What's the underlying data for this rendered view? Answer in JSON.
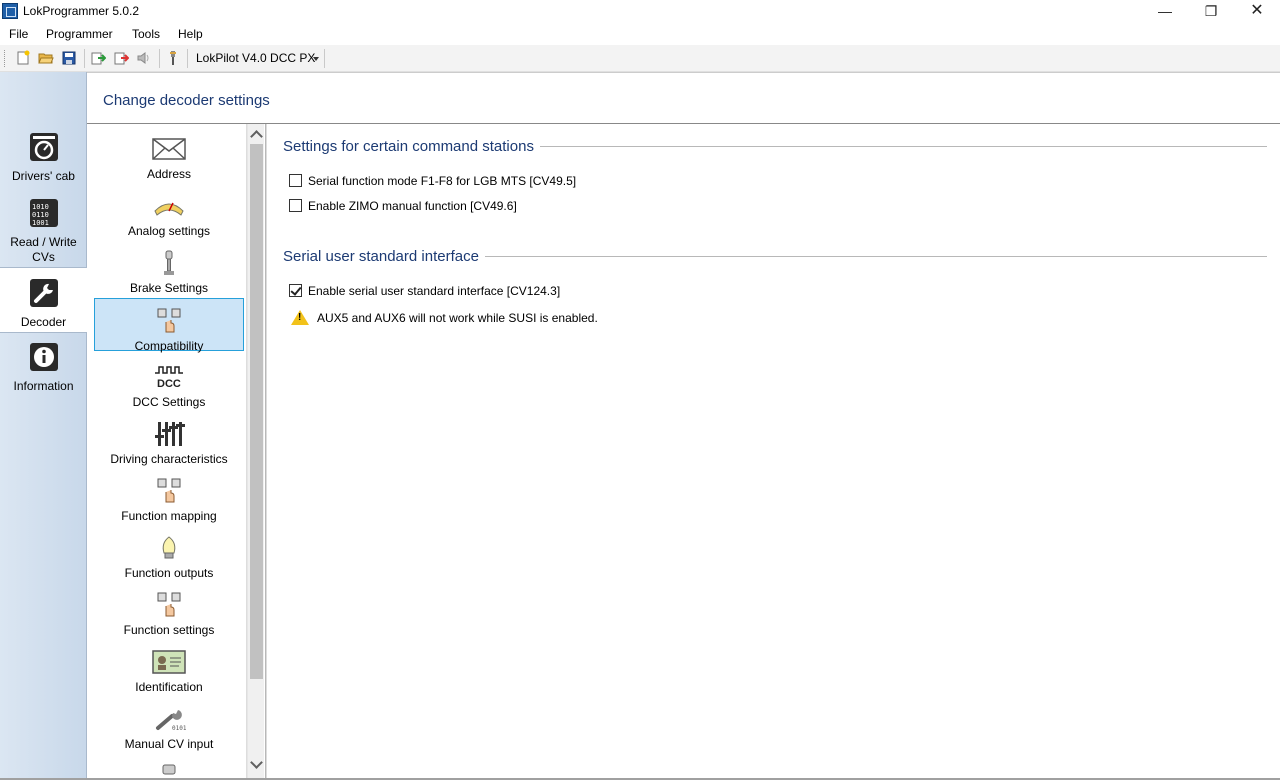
{
  "window": {
    "title": "LokProgrammer 5.0.2",
    "minimize_glyph": "—",
    "maximize_glyph": "❐",
    "close_glyph": "✕"
  },
  "menu": [
    "File",
    "Programmer",
    "Tools",
    "Help"
  ],
  "toolbar": {
    "decoder_select": "LokPilot V4.0 DCC PX",
    "icons": [
      "new-file-icon",
      "open-folder-icon",
      "save-icon",
      "import-icon",
      "export-icon",
      "speaker-icon",
      "programmer-key-icon"
    ]
  },
  "leftnav": [
    {
      "label": "Drivers' cab",
      "icon": "drivers-cab-icon"
    },
    {
      "label": "Read / Write CVs",
      "icon": "read-write-cvs-icon"
    },
    {
      "label": "Decoder",
      "icon": "wrench-icon",
      "active": true
    },
    {
      "label": "Information",
      "icon": "info-icon"
    }
  ],
  "page_title": "Change decoder settings",
  "categories": [
    {
      "label": "Address",
      "icon": "envelope-icon"
    },
    {
      "label": "Analog settings",
      "icon": "analog-gauge-icon"
    },
    {
      "label": "Brake Settings",
      "icon": "brake-icon"
    },
    {
      "label": "Compatibility",
      "icon": "hand-buttons-icon",
      "active": true
    },
    {
      "label": "DCC Settings",
      "icon": "dcc-icon",
      "icon_text": "DCC"
    },
    {
      "label": "Driving characteristics",
      "icon": "sliders-icon"
    },
    {
      "label": "Function mapping",
      "icon": "hand-buttons-icon"
    },
    {
      "label": "Function outputs",
      "icon": "light-bulb-icon"
    },
    {
      "label": "Function settings",
      "icon": "hand-buttons-icon"
    },
    {
      "label": "Identification",
      "icon": "id-card-icon"
    },
    {
      "label": "Manual CV input",
      "icon": "wrench-icon"
    }
  ],
  "sections": {
    "command_stations": {
      "title": "Settings for certain command stations",
      "options": [
        {
          "label": "Serial function mode F1-F8 for LGB MTS [CV49.5]",
          "checked": false
        },
        {
          "label": "Enable ZIMO manual function [CV49.6]",
          "checked": false
        }
      ]
    },
    "susi": {
      "title": "Serial user standard interface",
      "options": [
        {
          "label": "Enable serial user standard interface [CV124.3]",
          "checked": true
        }
      ],
      "warning": "AUX5 and AUX6 will not work while SUSI is enabled."
    }
  },
  "colors": {
    "accent_title": "#1c3a73",
    "selection_bg": "#cce4f7",
    "selection_border": "#26a0da",
    "nav_bg": "#c8d8ea",
    "warning": "#f2c21a"
  }
}
